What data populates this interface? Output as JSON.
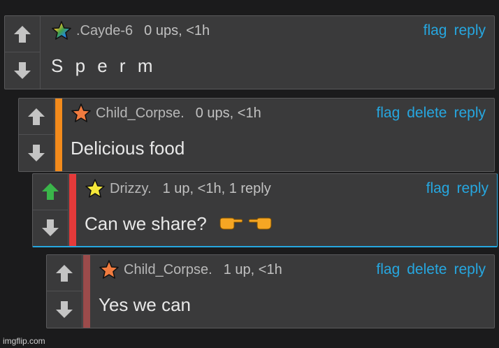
{
  "colors": {
    "link": "#26a7e0",
    "upvote_active": "#3ab54a",
    "arrow_inactive": "#c4c4c4",
    "stripe_orange": "#f38b1c",
    "stripe_red": "#e53a3a",
    "stripe_brown": "#9b4b4b",
    "selected_border": "#26a7e0"
  },
  "comments": [
    {
      "username": ".Cayde-6",
      "meta": "0 ups, <1h",
      "text": "S p e r m",
      "actions": [
        "flag",
        "reply"
      ],
      "badge_icon": "rainbow-star-icon",
      "upvoted": false
    },
    {
      "username": "Child_Corpse.",
      "meta": "0 ups, <1h",
      "text": "Delicious food",
      "actions": [
        "flag",
        "delete",
        "reply"
      ],
      "badge_icon": "orange-star-icon",
      "upvoted": false
    },
    {
      "username": "Drizzy.",
      "meta": "1 up, <1h, 1 reply",
      "text": "Can we share?",
      "actions": [
        "flag",
        "reply"
      ],
      "badge_icon": "yellow-star-icon",
      "upvoted": true,
      "emoji": [
        "pointing-right-hand-icon",
        "pointing-left-hand-icon"
      ]
    },
    {
      "username": "Child_Corpse.",
      "meta": "1 up, <1h",
      "text": "Yes we can",
      "actions": [
        "flag",
        "delete",
        "reply"
      ],
      "badge_icon": "orange-star-icon",
      "upvoted": false
    }
  ],
  "watermark": "imgflip.com"
}
